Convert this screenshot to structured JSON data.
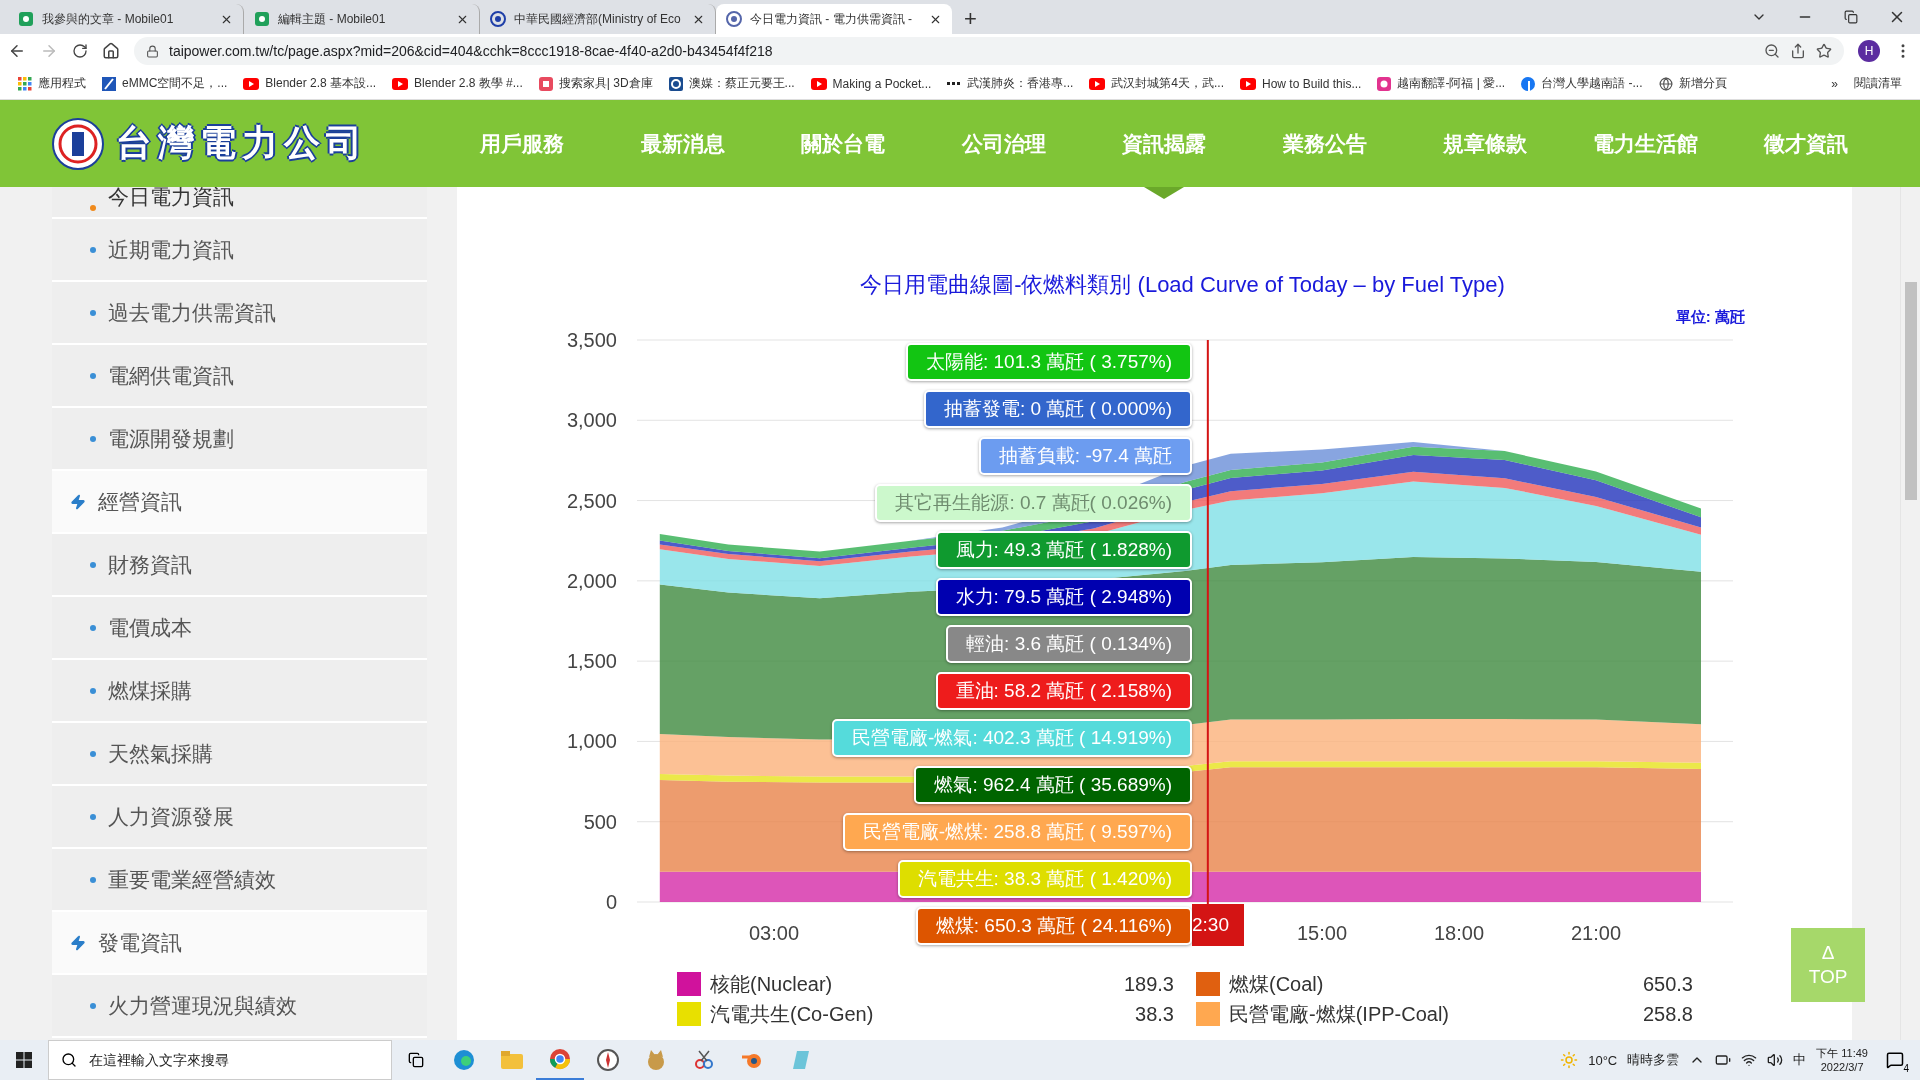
{
  "browser": {
    "tabs": [
      {
        "title": "我參與的文章 - Mobile01",
        "selected": false
      },
      {
        "title": "編輯主題 - Mobile01",
        "selected": false
      },
      {
        "title": "中華民國經濟部(Ministry of Eco",
        "selected": false
      },
      {
        "title": "今日電力資訊 - 電力供需資訊 -",
        "selected": true
      }
    ],
    "new_tab": "+",
    "address": "taipower.com.tw/tc/page.aspx?mid=206&cid=404&cchk=8ccc1918-8cae-4f40-a2d0-b43454f4f218",
    "profile": "H",
    "bookmarks": [
      "應用程式",
      "eMMC空間不足，...",
      "Blender 2.8 基本設...",
      "Blender 2.8 教學 #...",
      "搜索家具| 3D倉庫",
      "澳媒：蔡正元要王...",
      "Making a Pocket...",
      "武漢肺炎：香港專...",
      "武汉封城第4天，武...",
      "How to Build this...",
      "越南翻譯-阿福 | 愛...",
      "台灣人學越南語 -...",
      "新增分頁"
    ],
    "more": "»",
    "reading_list": "閱讀清單"
  },
  "header": {
    "logo_text": "台灣電力公司",
    "nav": [
      {
        "label": "用戶服務",
        "selected": false
      },
      {
        "label": "最新消息",
        "selected": false
      },
      {
        "label": "關於台電",
        "selected": false
      },
      {
        "label": "公司治理",
        "selected": false
      },
      {
        "label": "資訊揭露",
        "selected": true
      },
      {
        "label": "業務公告",
        "selected": false
      },
      {
        "label": "規章條款",
        "selected": false
      },
      {
        "label": "電力生活館",
        "selected": false
      },
      {
        "label": "徵才資訊",
        "selected": false
      }
    ]
  },
  "sidebar": {
    "items": [
      {
        "label": "今日電力資訊",
        "kind": "link",
        "selected": true
      },
      {
        "label": "近期電力資訊",
        "kind": "link",
        "selected": false
      },
      {
        "label": "過去電力供需資訊",
        "kind": "link",
        "selected": false
      },
      {
        "label": "電網供電資訊",
        "kind": "link",
        "selected": false
      },
      {
        "label": "電源開發規劃",
        "kind": "link",
        "selected": false
      },
      {
        "label": "經營資訊",
        "kind": "section",
        "selected": false
      },
      {
        "label": "財務資訊",
        "kind": "link",
        "selected": false
      },
      {
        "label": "電價成本",
        "kind": "link",
        "selected": false
      },
      {
        "label": "燃煤採購",
        "kind": "link",
        "selected": false
      },
      {
        "label": "天然氣採購",
        "kind": "link",
        "selected": false
      },
      {
        "label": "人力資源發展",
        "kind": "link",
        "selected": false
      },
      {
        "label": "重要電業經營績效",
        "kind": "link",
        "selected": false
      },
      {
        "label": "發電資訊",
        "kind": "section",
        "selected": false
      },
      {
        "label": "火力營運現況與績效",
        "kind": "link",
        "selected": false
      }
    ]
  },
  "chart": {
    "title": "今日用電曲線圖-依燃料類別 (Load Curve of Today – by Fuel Type)",
    "unit": "單位: 萬瓩",
    "time_marker": "2:30",
    "y_axis_labels": [
      "3,500",
      "3,000",
      "2,500",
      "2,000",
      "1,500",
      "1,000",
      "500",
      "0"
    ],
    "x_axis_labels": [
      "03:00",
      "15:00",
      "18:00",
      "21:00"
    ],
    "tooltips": [
      {
        "label": "太陽能: 101.3 萬瓩 ( 3.757%)",
        "color": "#12c512"
      },
      {
        "label": "抽蓄發電: 0 萬瓩 ( 0.000%)",
        "color": "#3366cc"
      },
      {
        "label": "抽蓄負載: -97.4 萬瓩",
        "color": "#6c9cf0"
      },
      {
        "label": "其它再生能源: 0.7 萬瓩( 0.026%)",
        "color": "#ccf8cc"
      },
      {
        "label": "風力: 49.3 萬瓩 ( 1.828%)",
        "color": "#0f9a2f"
      },
      {
        "label": "水力: 79.5 萬瓩 ( 2.948%)",
        "color": "#0000b0"
      },
      {
        "label": "輕油: 3.6 萬瓩 ( 0.134%)",
        "color": "#888888"
      },
      {
        "label": "重油: 58.2 萬瓩 ( 2.158%)",
        "color": "#ee1c1c"
      },
      {
        "label": "民營電廠-燃氣: 402.3 萬瓩 ( 14.919%)",
        "color": "#55dbdb"
      },
      {
        "label": "燃氣: 962.4 萬瓩 ( 35.689%)",
        "color": "#006400"
      },
      {
        "label": "民營電廠-燃煤: 258.8 萬瓩 ( 9.597%)",
        "color": "#ffa850"
      },
      {
        "label": "汽電共生: 38.3 萬瓩 ( 1.420%)",
        "color": "#dede00"
      },
      {
        "label": "燃煤: 650.3 萬瓩 ( 24.116%)",
        "color": "#dd5500"
      }
    ]
  },
  "legend": [
    {
      "label": "核能(Nuclear)",
      "value": "189.3",
      "color": "#d0129c"
    },
    {
      "label": "燃煤(Coal)",
      "value": "650.3",
      "color": "#e06010"
    },
    {
      "label": "汽電共生(Co-Gen)",
      "value": "38.3",
      "color": "#e8e000"
    },
    {
      "label": "民營電廠-燃煤(IPP-Coal)",
      "value": "258.8",
      "color": "#ffa850"
    }
  ],
  "top_button": {
    "symbol": "Δ",
    "label": "TOP"
  },
  "taskbar": {
    "search_placeholder": "在這裡輸入文字來搜尋",
    "temperature": "10°C",
    "weather": "晴時多雲",
    "ime": "中",
    "time": "下午 11:49",
    "date": "2022/3/7",
    "notifications": "4"
  }
}
